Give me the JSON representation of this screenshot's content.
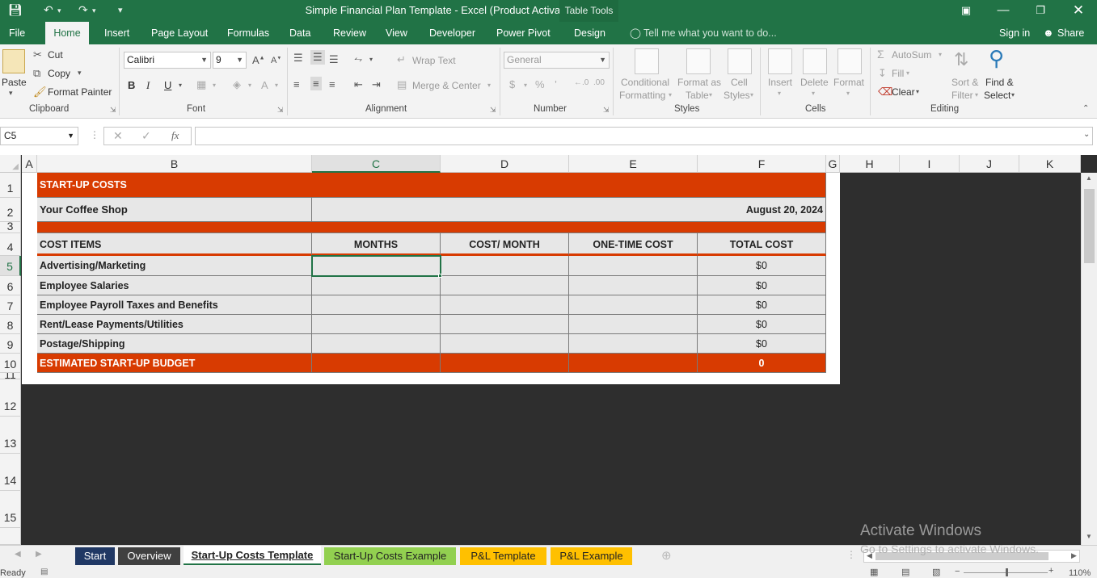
{
  "window": {
    "title": "Simple Financial Plan Template - Excel (Product Activation Failed)",
    "contextual_tab_group": "Table Tools"
  },
  "tabs": {
    "file": "File",
    "home": "Home",
    "insert": "Insert",
    "page_layout": "Page Layout",
    "formulas": "Formulas",
    "data": "Data",
    "review": "Review",
    "view": "View",
    "developer": "Developer",
    "power_pivot": "Power Pivot",
    "design": "Design",
    "tell_me": "Tell me what you want to do...",
    "sign_in": "Sign in",
    "share": "Share"
  },
  "ribbon": {
    "clipboard": {
      "label": "Clipboard",
      "paste": "Paste",
      "cut": "Cut",
      "copy": "Copy",
      "format_painter": "Format Painter"
    },
    "font": {
      "label": "Font",
      "font_name": "Calibri",
      "font_size": "9"
    },
    "alignment": {
      "label": "Alignment",
      "wrap_text": "Wrap Text",
      "merge_center": "Merge & Center"
    },
    "number": {
      "label": "Number",
      "format": "General"
    },
    "styles": {
      "label": "Styles",
      "conditional_formatting_1": "Conditional",
      "conditional_formatting_2": "Formatting",
      "format_as_table_1": "Format as",
      "format_as_table_2": "Table",
      "cell_styles_1": "Cell",
      "cell_styles_2": "Styles"
    },
    "cells": {
      "label": "Cells",
      "insert": "Insert",
      "delete": "Delete",
      "format": "Format"
    },
    "editing": {
      "label": "Editing",
      "autosum": "AutoSum",
      "fill": "Fill",
      "clear": "Clear",
      "sort_filter_1": "Sort &",
      "sort_filter_2": "Filter",
      "find_select_1": "Find &",
      "find_select_2": "Select"
    }
  },
  "formula_bar": {
    "name_box": "C5",
    "value": ""
  },
  "grid": {
    "columns": [
      "A",
      "B",
      "C",
      "D",
      "E",
      "F",
      "G",
      "H",
      "I",
      "J",
      "K"
    ],
    "rows": [
      "1",
      "2",
      "3",
      "4",
      "5",
      "6",
      "7",
      "8",
      "9",
      "10",
      "11",
      "12",
      "13",
      "14",
      "15"
    ],
    "selected_cell": "C5"
  },
  "sheet": {
    "title": "START-UP COSTS",
    "company": "Your Coffee Shop",
    "date": "August 20, 2024",
    "headers": [
      "COST ITEMS",
      "MONTHS",
      "COST/ MONTH",
      "ONE-TIME COST",
      "TOTAL COST"
    ],
    "items": [
      {
        "name": "Advertising/Marketing",
        "months": "",
        "cost_month": "",
        "one_time": "",
        "total": "$0"
      },
      {
        "name": "Employee Salaries",
        "months": "",
        "cost_month": "",
        "one_time": "",
        "total": "$0"
      },
      {
        "name": "Employee Payroll Taxes and Benefits",
        "months": "",
        "cost_month": "",
        "one_time": "",
        "total": "$0"
      },
      {
        "name": "Rent/Lease Payments/Utilities",
        "months": "",
        "cost_month": "",
        "one_time": "",
        "total": "$0"
      },
      {
        "name": "Postage/Shipping",
        "months": "",
        "cost_month": "",
        "one_time": "",
        "total": "$0"
      }
    ],
    "total_label": "ESTIMATED START-UP BUDGET",
    "total_value": "0"
  },
  "sheet_tabs": [
    {
      "label": "Start",
      "color": "#203864",
      "text_color": "#ffffff"
    },
    {
      "label": "Overview",
      "color": "#404040",
      "text_color": "#ffffff"
    },
    {
      "label": "Start-Up Costs Template",
      "color": "#ffffff",
      "text_color": "#222222",
      "active": true
    },
    {
      "label": "Start-Up Costs Example",
      "color": "#92d050",
      "text_color": "#222222"
    },
    {
      "label": "P&L Template",
      "color": "#ffc000",
      "text_color": "#222222"
    },
    {
      "label": "P&L Example",
      "color": "#ffc000",
      "text_color": "#222222"
    }
  ],
  "status": {
    "ready": "Ready",
    "zoom": "110%"
  },
  "watermark": {
    "line1": "Activate Windows",
    "line2": "Go to Settings to activate Windows."
  },
  "colors": {
    "excel_green": "#217346",
    "band_orange": "#d83b01",
    "cell_gray": "#e7e7e7",
    "outside_area": "#2e2e2e"
  }
}
